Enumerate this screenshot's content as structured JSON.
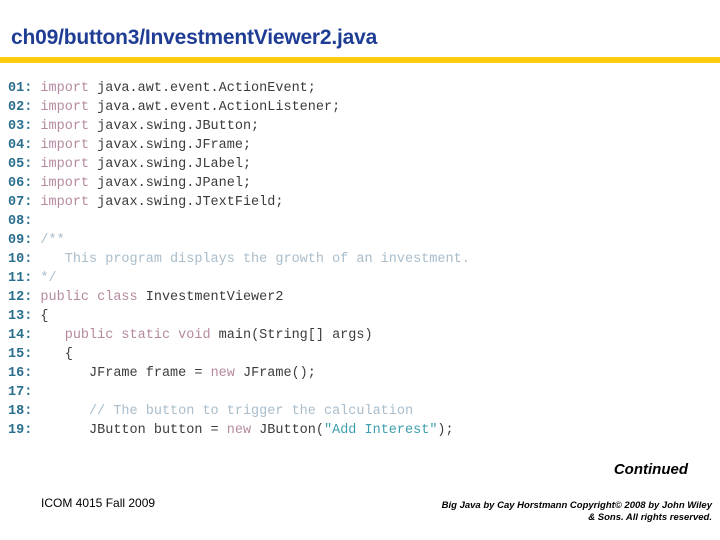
{
  "slide": {
    "title": "ch09/button3/InvestmentViewer2.java",
    "rule_color": "#FFCC11",
    "title_color": "#1F3D94"
  },
  "code": {
    "language": "java",
    "colors": {
      "line_number": "#2A6E8E",
      "plain": "#3C3C3C",
      "keyword": "#B58AA0",
      "comment": "#A9BDCB",
      "string": "#3C9FAE"
    },
    "lines": [
      {
        "num": "01:",
        "tokens": [
          {
            "t": "keyword",
            "s": "import"
          },
          {
            "t": "plain",
            "s": " java.awt.event.ActionEvent;"
          }
        ]
      },
      {
        "num": "02:",
        "tokens": [
          {
            "t": "keyword",
            "s": "import"
          },
          {
            "t": "plain",
            "s": " java.awt.event.ActionListener;"
          }
        ]
      },
      {
        "num": "03:",
        "tokens": [
          {
            "t": "keyword",
            "s": "import"
          },
          {
            "t": "plain",
            "s": " javax.swing.JButton;"
          }
        ]
      },
      {
        "num": "04:",
        "tokens": [
          {
            "t": "keyword",
            "s": "import"
          },
          {
            "t": "plain",
            "s": " javax.swing.JFrame;"
          }
        ]
      },
      {
        "num": "05:",
        "tokens": [
          {
            "t": "keyword",
            "s": "import"
          },
          {
            "t": "plain",
            "s": " javax.swing.JLabel;"
          }
        ]
      },
      {
        "num": "06:",
        "tokens": [
          {
            "t": "keyword",
            "s": "import"
          },
          {
            "t": "plain",
            "s": " javax.swing.JPanel;"
          }
        ]
      },
      {
        "num": "07:",
        "tokens": [
          {
            "t": "keyword",
            "s": "import"
          },
          {
            "t": "plain",
            "s": " javax.swing.JTextField;"
          }
        ]
      },
      {
        "num": "08:",
        "tokens": []
      },
      {
        "num": "09:",
        "tokens": [
          {
            "t": "comment",
            "s": "/**"
          }
        ]
      },
      {
        "num": "10:",
        "tokens": [
          {
            "t": "comment",
            "s": "   This program displays the growth of an investment."
          }
        ]
      },
      {
        "num": "11:",
        "tokens": [
          {
            "t": "comment",
            "s": "*/"
          }
        ]
      },
      {
        "num": "12:",
        "tokens": [
          {
            "t": "keyword",
            "s": "public class"
          },
          {
            "t": "plain",
            "s": " InvestmentViewer2"
          }
        ]
      },
      {
        "num": "13:",
        "tokens": [
          {
            "t": "plain",
            "s": "{"
          }
        ]
      },
      {
        "num": "14:",
        "tokens": [
          {
            "t": "keyword",
            "s": "   public static void"
          },
          {
            "t": "plain",
            "s": " main(String[] args)"
          }
        ]
      },
      {
        "num": "15:",
        "tokens": [
          {
            "t": "plain",
            "s": "   {"
          }
        ]
      },
      {
        "num": "16:",
        "tokens": [
          {
            "t": "plain",
            "s": "      JFrame frame = "
          },
          {
            "t": "keyword",
            "s": "new"
          },
          {
            "t": "plain",
            "s": " JFrame();"
          }
        ]
      },
      {
        "num": "17:",
        "tokens": []
      },
      {
        "num": "18:",
        "tokens": [
          {
            "t": "comment",
            "s": "      // The button to trigger the calculation"
          }
        ]
      },
      {
        "num": "19:",
        "tokens": [
          {
            "t": "plain",
            "s": "      JButton button = "
          },
          {
            "t": "keyword",
            "s": "new"
          },
          {
            "t": "plain",
            "s": " JButton("
          },
          {
            "t": "string",
            "s": "\"Add Interest\""
          },
          {
            "t": "plain",
            "s": ");"
          }
        ]
      }
    ]
  },
  "footer": {
    "continued_label": "Continued",
    "course": "ICOM 4015 Fall 2009",
    "copyright_line1": "Big Java by Cay Horstmann Copyright© 2008 by John Wiley",
    "copyright_line2": "& Sons.  All rights reserved."
  }
}
